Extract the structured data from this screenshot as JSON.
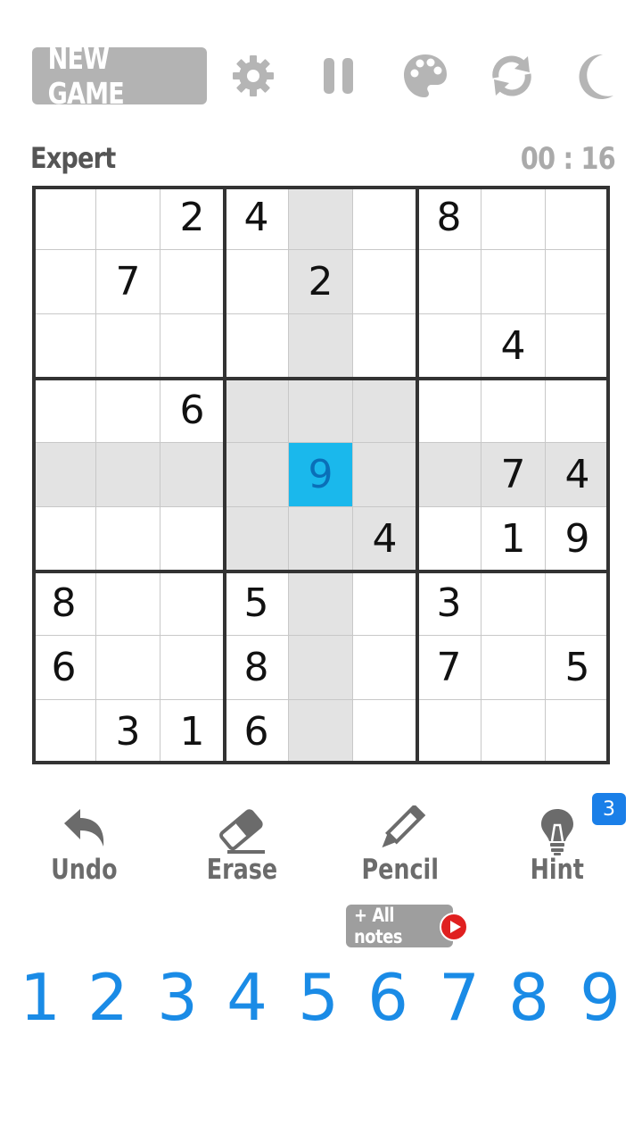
{
  "toolbar": {
    "new_game_label": "NEW GAME",
    "icons": [
      "gear-icon",
      "pause-icon",
      "palette-icon",
      "refresh-icon",
      "moon-icon"
    ]
  },
  "status": {
    "difficulty": "Expert",
    "timer": "00 : 16"
  },
  "board": {
    "selected": {
      "row": 4,
      "col": 4
    },
    "rows": [
      [
        "",
        "",
        "2",
        "4",
        "",
        "",
        "8",
        "",
        ""
      ],
      [
        "",
        "7",
        "",
        "",
        "2",
        "",
        "",
        "",
        ""
      ],
      [
        "",
        "",
        "",
        "",
        "",
        "",
        "",
        "4",
        ""
      ],
      [
        "",
        "",
        "6",
        "",
        "",
        "",
        "",
        "",
        ""
      ],
      [
        "",
        "",
        "",
        "",
        "9",
        "",
        "",
        "7",
        "4"
      ],
      [
        "",
        "",
        "",
        "",
        "",
        "4",
        "",
        "1",
        "9"
      ],
      [
        "8",
        "",
        "",
        "5",
        "",
        "",
        "3",
        "",
        ""
      ],
      [
        "6",
        "",
        "",
        "8",
        "",
        "",
        "7",
        "",
        "5"
      ],
      [
        "",
        "3",
        "1",
        "6",
        "",
        "",
        "",
        "",
        ""
      ]
    ]
  },
  "actions": {
    "undo_label": "Undo",
    "erase_label": "Erase",
    "pencil_label": "Pencil",
    "hint_label": "Hint",
    "hint_count": "3",
    "all_notes_label": "+ All notes"
  },
  "numpad": [
    "1",
    "2",
    "3",
    "4",
    "5",
    "6",
    "7",
    "8",
    "9"
  ],
  "colors": {
    "selected_cell": "#1ab8ec",
    "highlight": "#e3e3e3",
    "numpad_digits": "#1a8be6",
    "hint_badge": "#1a7fe8"
  }
}
